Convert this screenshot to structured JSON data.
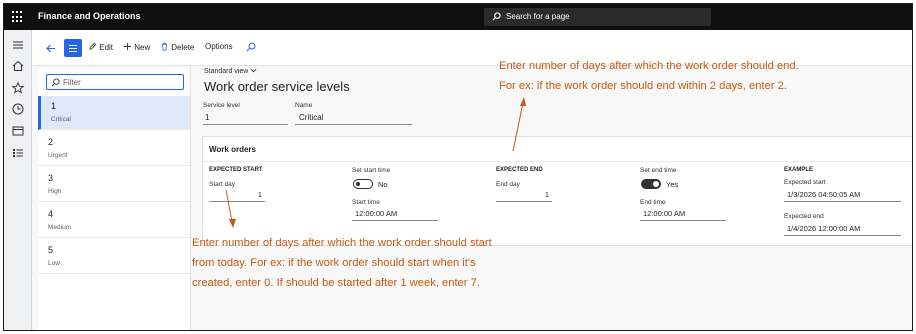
{
  "app": {
    "title": "Finance and Operations"
  },
  "search": {
    "placeholder": "Search for a page"
  },
  "rail": {
    "icons": [
      "hamburger-icon",
      "home-icon",
      "star-icon",
      "clock-icon",
      "workspace-icon",
      "list-icon"
    ]
  },
  "actions": {
    "edit": "Edit",
    "new": "New",
    "delete": "Delete",
    "options": "Options"
  },
  "list": {
    "filter_placeholder": "Filter",
    "items": [
      {
        "code": "1",
        "name": "Critical"
      },
      {
        "code": "2",
        "name": "Urgent"
      },
      {
        "code": "3",
        "name": "High"
      },
      {
        "code": "4",
        "name": "Medium"
      },
      {
        "code": "5",
        "name": "Low"
      }
    ]
  },
  "form": {
    "view": "Standard view",
    "title": "Work order service levels",
    "service_level_label": "Service level",
    "service_level_value": "1",
    "name_label": "Name",
    "name_value": "Critical"
  },
  "work_orders": {
    "title": "Work orders",
    "expected_start": {
      "header": "EXPECTED START",
      "start_day_label": "Start day",
      "start_day_value": "1",
      "set_start_time_label": "Set start time",
      "set_start_time_value": "No",
      "start_time_label": "Start time",
      "start_time_value": "12:00:00 AM"
    },
    "expected_end": {
      "header": "EXPECTED END",
      "end_day_label": "End day",
      "end_day_value": "1",
      "set_end_time_label": "Set end time",
      "set_end_time_value": "Yes",
      "end_time_label": "End time",
      "end_time_value": "12:00:00 AM"
    },
    "example": {
      "header": "EXAMPLE",
      "expected_start_label": "Expected start",
      "expected_start_value": "1/3/2026 04:50:05 AM",
      "expected_end_label": "Expected end",
      "expected_end_value": "1/4/2026 12:00:00 AM"
    }
  },
  "annotations": {
    "end_note_line1": "Enter number of days after which the work order should end.",
    "end_note_line2": "For ex: if the work order should end within 2 days, enter 2.",
    "start_note_line1": "Enter number of days after which the work order should start",
    "start_note_line2": "from today. For ex: if the work order should start when it's",
    "start_note_line3": "created, enter 0. If should be started after 1 week, enter 7.",
    "color": "#c55a11"
  },
  "colors": {
    "accent": "#2266e3",
    "topbar": "#0f0f0f"
  }
}
